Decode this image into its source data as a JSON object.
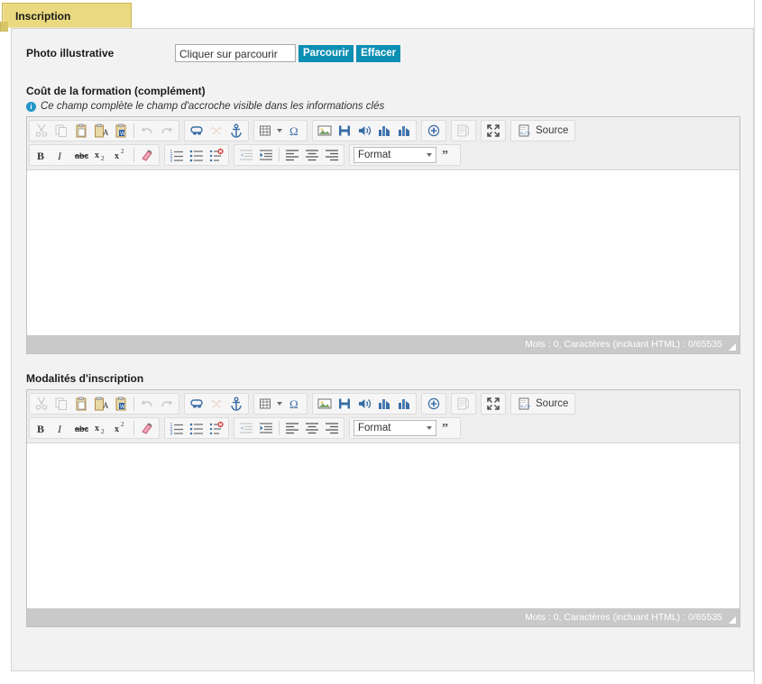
{
  "tab": {
    "label": "Inscription"
  },
  "photo": {
    "label": "Photo illustrative",
    "input_value": "Cliquer sur parcourir",
    "browse_label": "Parcourir",
    "clear_label": "Effacer"
  },
  "sections": [
    {
      "label": "Coût de la formation (complément)",
      "hint": "Ce champ complète le champ d'accroche visible dans les informations clés",
      "hint_icon": "info-icon",
      "editor": {
        "content": "",
        "status": "Mots : 0, Caractères (incluant HTML) : 0/65535",
        "format_label": "Format",
        "source_label": "Source",
        "body_height": 182
      }
    },
    {
      "label": "Modalités d'inscription",
      "hint": null,
      "editor": {
        "content": "",
        "status": "Mots : 0, Caractères (incluant HTML) : 0/65535",
        "format_label": "Format",
        "source_label": "Source",
        "body_height": 182
      }
    }
  ],
  "toolbar": {
    "row1": [
      {
        "group": 1,
        "name": "cut-icon",
        "title": "Couper",
        "dim": true
      },
      {
        "group": 1,
        "name": "copy-icon",
        "title": "Copier",
        "dim": true
      },
      {
        "group": 1,
        "name": "paste-icon",
        "title": "Coller",
        "dim": false
      },
      {
        "group": 1,
        "name": "paste-text-icon",
        "title": "Coller comme texte",
        "dim": false
      },
      {
        "group": 1,
        "name": "paste-word-icon",
        "title": "Coller depuis Word",
        "dim": false
      },
      {
        "group": 1,
        "name": "separator",
        "title": "",
        "dim": false
      },
      {
        "group": 1,
        "name": "undo-icon",
        "title": "Annuler",
        "dim": true
      },
      {
        "group": 1,
        "name": "redo-icon",
        "title": "Rétablir",
        "dim": true
      },
      {
        "group": 2,
        "name": "link-icon",
        "title": "Lien",
        "dim": false
      },
      {
        "group": 2,
        "name": "unlink-icon",
        "title": "Supprimer le lien",
        "dim": true
      },
      {
        "group": 2,
        "name": "anchor-icon",
        "title": "Ancre",
        "dim": false
      },
      {
        "group": 3,
        "name": "table-icon",
        "title": "Tableau",
        "dim": false
      },
      {
        "group": 3,
        "name": "special-char-icon",
        "title": "Caractère spécial",
        "dim": false
      },
      {
        "group": 4,
        "name": "image-icon",
        "title": "Image",
        "dim": false
      },
      {
        "group": 4,
        "name": "video-icon",
        "title": "Vidéo",
        "dim": false
      },
      {
        "group": 4,
        "name": "audio-icon",
        "title": "Son",
        "dim": false
      },
      {
        "group": 4,
        "name": "chart-icon",
        "title": "Graphique",
        "dim": false
      },
      {
        "group": 4,
        "name": "chart-alt-icon",
        "title": "Graphique",
        "dim": false
      },
      {
        "group": 5,
        "name": "insert-plus-icon",
        "title": "Insérer",
        "dim": false
      },
      {
        "group": 6,
        "name": "template-icon",
        "title": "Modèles",
        "dim": true
      },
      {
        "group": 7,
        "name": "maximize-icon",
        "title": "Agrandir",
        "dim": false
      },
      {
        "group": 8,
        "name": "source-button",
        "title": "Source",
        "dim": false
      }
    ],
    "row2": [
      {
        "group": 1,
        "name": "bold-icon",
        "title": "Gras",
        "dim": false
      },
      {
        "group": 1,
        "name": "italic-icon",
        "title": "Italique",
        "dim": false
      },
      {
        "group": 1,
        "name": "strike-icon",
        "title": "Barré",
        "dim": false
      },
      {
        "group": 1,
        "name": "subscript-icon",
        "title": "Indice",
        "dim": false
      },
      {
        "group": 1,
        "name": "superscript-icon",
        "title": "Exposant",
        "dim": false
      },
      {
        "group": 1,
        "name": "separator",
        "title": "",
        "dim": false
      },
      {
        "group": 1,
        "name": "remove-format-icon",
        "title": "Supprimer le format",
        "dim": false
      },
      {
        "group": 2,
        "name": "numbered-list-icon",
        "title": "Liste numérotée",
        "dim": false
      },
      {
        "group": 2,
        "name": "bulleted-list-icon",
        "title": "Liste à puces",
        "dim": false
      },
      {
        "group": 2,
        "name": "custom-list-icon",
        "title": "Liste",
        "dim": false
      },
      {
        "group": 3,
        "name": "outdent-icon",
        "title": "Diminuer le retrait",
        "dim": true
      },
      {
        "group": 3,
        "name": "indent-icon",
        "title": "Augmenter le retrait",
        "dim": false
      },
      {
        "group": 3,
        "name": "separator",
        "title": "",
        "dim": false
      },
      {
        "group": 3,
        "name": "align-left-icon",
        "title": "Aligner à gauche",
        "dim": false
      },
      {
        "group": 3,
        "name": "align-center-icon",
        "title": "Centrer",
        "dim": false
      },
      {
        "group": 3,
        "name": "align-right-icon",
        "title": "Aligner à droite",
        "dim": false
      },
      {
        "group": 4,
        "name": "format-select",
        "title": "Format",
        "dim": false
      },
      {
        "group": 4,
        "name": "blockquote-icon",
        "title": "Citation",
        "dim": false
      }
    ]
  },
  "colors": {
    "tab_bg": "#ead97f",
    "tab_border": "#c9b65b",
    "button_teal": "#0d8fb4",
    "panel_bg": "#f2f2f2",
    "status_bar_bg": "#c9c9c9",
    "hint_icon_bg": "#2196c9",
    "icon_blue": "#3a6ea5"
  }
}
